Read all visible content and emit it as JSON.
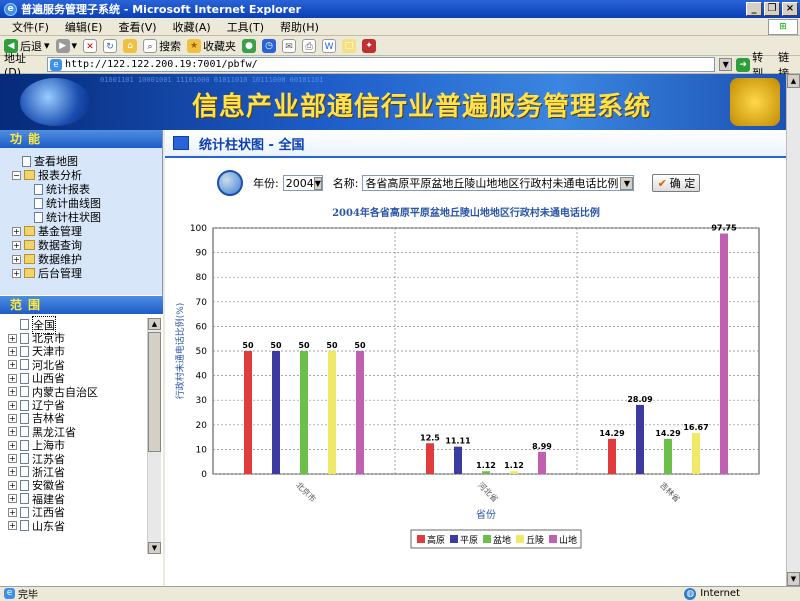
{
  "window": {
    "title": "普遍服务管理子系统 - Microsoft Internet Explorer"
  },
  "menu": [
    "文件(F)",
    "编辑(E)",
    "查看(V)",
    "收藏(A)",
    "工具(T)",
    "帮助(H)"
  ],
  "toolbar": {
    "back": "后退",
    "search": "搜索",
    "favorites": "收藏夹"
  },
  "address": {
    "label": "地址(D)",
    "url": "http://122.122.200.19:7001/pbfw/",
    "go": "转到",
    "links": "链接"
  },
  "banner": {
    "title": "信息产业部通信行业普遍服务管理系统"
  },
  "function_panel": {
    "title": "功能",
    "items": [
      {
        "label": "查看地图",
        "level": 1,
        "kind": "doc"
      },
      {
        "label": "报表分析",
        "level": 0,
        "kind": "folder-open"
      },
      {
        "label": "统计报表",
        "level": 2,
        "kind": "doc"
      },
      {
        "label": "统计曲线图",
        "level": 2,
        "kind": "doc"
      },
      {
        "label": "统计柱状图",
        "level": 2,
        "kind": "doc"
      },
      {
        "label": "基金管理",
        "level": 0,
        "kind": "folder"
      },
      {
        "label": "数据查询",
        "level": 0,
        "kind": "folder"
      },
      {
        "label": "数据维护",
        "level": 0,
        "kind": "folder"
      },
      {
        "label": "后台管理",
        "level": 0,
        "kind": "folder"
      }
    ]
  },
  "range_panel": {
    "title": "范围",
    "root": "全国",
    "items": [
      "北京市",
      "天津市",
      "河北省",
      "山西省",
      "内蒙古自治区",
      "辽宁省",
      "吉林省",
      "黑龙江省",
      "上海市",
      "江苏省",
      "浙江省",
      "安徽省",
      "福建省",
      "江西省",
      "山东省"
    ]
  },
  "main": {
    "header": "统计柱状图 - 全国",
    "year_label": "年份:",
    "year_value": "2004",
    "name_label": "名称:",
    "name_value": "各省高原平原盆地丘陵山地地区行政村未通电话比例",
    "ok_button": "确 定"
  },
  "chart_data": {
    "type": "bar",
    "title": "2004年各省高原平原盆地丘陵山地地区行政村未通电话比例",
    "xlabel": "省份",
    "ylabel": "行政村未通电话比例(%)",
    "ylim": [
      0,
      100
    ],
    "yticks": [
      0,
      10,
      20,
      30,
      40,
      50,
      60,
      70,
      80,
      90,
      100
    ],
    "categories": [
      "北京市",
      "河北省",
      "吉林省"
    ],
    "series": [
      {
        "name": "高原",
        "color": "#e03c3c",
        "values": [
          50,
          12.5,
          14.29
        ],
        "labels": [
          "50",
          "12.5",
          "14.29"
        ]
      },
      {
        "name": "平原",
        "color": "#3c3ca0",
        "values": [
          50,
          11.11,
          28.09
        ],
        "labels": [
          "50",
          "11.11",
          "28.09"
        ]
      },
      {
        "name": "盆地",
        "color": "#6cc04a",
        "values": [
          50,
          1.12,
          14.29
        ],
        "labels": [
          "50",
          "1.12",
          "14.29"
        ]
      },
      {
        "name": "丘陵",
        "color": "#f0e868",
        "values": [
          50,
          1.12,
          16.67
        ],
        "labels": [
          "50",
          "1.12",
          "16.67"
        ]
      },
      {
        "name": "山地",
        "color": "#c060b0",
        "values": [
          50,
          8.99,
          97.75
        ],
        "labels": [
          "50",
          "8.99",
          "97.75"
        ]
      }
    ],
    "grid": true,
    "legend": "bottom"
  },
  "status": {
    "left": "完毕",
    "zone": "Internet"
  }
}
